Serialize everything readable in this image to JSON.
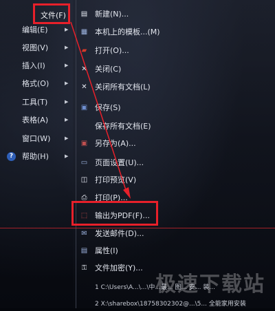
{
  "left_menu": {
    "file_label": "文件(F)",
    "items": [
      {
        "label": "编辑(E)",
        "arrow": "▶"
      },
      {
        "label": "视图(V)",
        "arrow": "▶"
      },
      {
        "label": "插入(I)",
        "arrow": "▶"
      },
      {
        "label": "格式(O)",
        "arrow": "▶"
      },
      {
        "label": "工具(T)",
        "arrow": "▶"
      },
      {
        "label": "表格(A)",
        "arrow": "▶"
      },
      {
        "label": "窗口(W)",
        "arrow": "▶"
      },
      {
        "label": "帮助(H)",
        "arrow": "▶"
      }
    ],
    "help_icon_glyph": "?"
  },
  "file_menu": {
    "items": [
      {
        "label": "新建(N)...",
        "icon": "new-document-icon",
        "glyph": "▤",
        "color": "#e8ecf4"
      },
      {
        "label": "本机上的模板...(M)",
        "icon": "template-icon",
        "glyph": "▦",
        "color": "#9db4e0"
      },
      {
        "label": "打开(O)...",
        "icon": "open-folder-icon",
        "glyph": "▰",
        "color": "#d43a2a"
      },
      {
        "label": "关闭(C)",
        "icon": "close-document-icon",
        "glyph": "✕",
        "color": "#e8ecf4"
      },
      {
        "label": "关闭所有文档(L)",
        "icon": "close-all-icon",
        "glyph": "✕",
        "color": "#e8ecf4"
      },
      {
        "label": "保存(S)",
        "icon": "save-icon",
        "glyph": "▣",
        "color": "#6f8fd0"
      },
      {
        "label": "保存所有文档(E)",
        "icon": "save-all-icon",
        "glyph": "",
        "color": "#e8ecf4"
      },
      {
        "label": "另存为(A)...",
        "icon": "save-as-icon",
        "glyph": "▣",
        "color": "#c05050"
      },
      {
        "label": "页面设置(U)...",
        "icon": "page-setup-icon",
        "glyph": "▭",
        "color": "#9db4e0"
      },
      {
        "label": "打印预览(V)",
        "icon": "print-preview-icon",
        "glyph": "◫",
        "color": "#e8ecf4"
      },
      {
        "label": "打印(P)...",
        "icon": "print-icon",
        "glyph": "⎙",
        "color": "#e8ecf4"
      },
      {
        "label": "输出为PDF(F)...",
        "icon": "pdf-export-icon",
        "glyph": "⬚",
        "color": "#e05050"
      },
      {
        "label": "发送邮件(D)...",
        "icon": "send-mail-icon",
        "glyph": "✉",
        "color": "#9db4e0"
      },
      {
        "label": "属性(I)",
        "icon": "properties-icon",
        "glyph": "▤",
        "color": "#9db4e0"
      },
      {
        "label": "文件加密(Y)...",
        "icon": "encrypt-icon",
        "glyph": "⚿",
        "color": "#e8ecf4"
      }
    ],
    "recent": [
      {
        "label": "1 C:\\Users\\A...\\...\\中...最... 图... 安... 装..."
      },
      {
        "label": "2 X:\\sharebox\\18758302302@...\\5... 全能家用安装"
      }
    ]
  },
  "watermark": "极速下载站",
  "colors": {
    "highlight": "#e8202a"
  }
}
